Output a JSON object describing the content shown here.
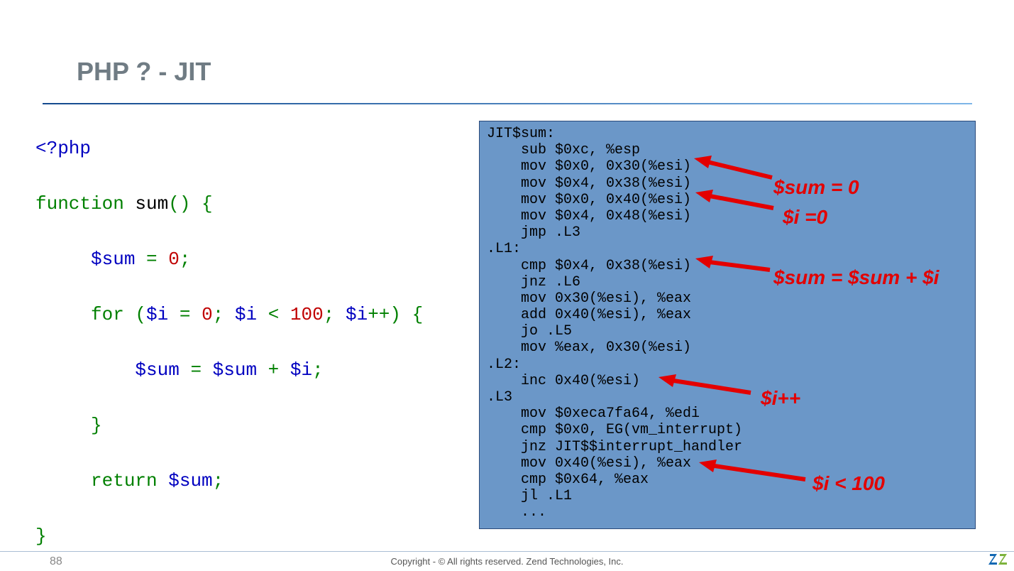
{
  "title": "PHP ? - JIT",
  "php": {
    "open": "<?php",
    "func": "function",
    "name": " sum",
    "paren": "() {",
    "l2a": "     $sum",
    "l2b": " = ",
    "l2c": "0",
    "l2d": ";",
    "l3a": "     for",
    "l3b": " (",
    "l3c": "$i",
    "l3d": " = ",
    "l3e": "0",
    "l3f": "; ",
    "l3g": "$i",
    "l3h": " < ",
    "l3i": "100",
    "l3j": "; ",
    "l3k": "$i",
    "l3l": "++) {",
    "l4a": "         $sum",
    "l4b": " = ",
    "l4c": "$sum",
    "l4d": " + ",
    "l4e": "$i",
    "l4f": ";",
    "l5": "     }",
    "l6a": "     return",
    "l6b": " $sum",
    "l6c": ";",
    "l7": "}"
  },
  "asm": "JIT$sum:\n    sub $0xc, %esp\n    mov $0x0, 0x30(%esi)\n    mov $0x4, 0x38(%esi)\n    mov $0x0, 0x40(%esi)\n    mov $0x4, 0x48(%esi)\n    jmp .L3\n.L1:\n    cmp $0x4, 0x38(%esi)\n    jnz .L6\n    mov 0x30(%esi), %eax\n    add 0x40(%esi), %eax\n    jo .L5\n    mov %eax, 0x30(%esi)\n.L2:\n    inc 0x40(%esi)\n.L3\n    mov $0xeca7fa64, %edi\n    cmp $0x0, EG(vm_interrupt)\n    jnz JIT$$interrupt_handler\n    mov 0x40(%esi), %eax\n    cmp $0x64, %eax\n    jl .L1\n    ...",
  "annotations": {
    "a1": "$sum = 0",
    "a2": "$i =0",
    "a3": "$sum = $sum + $i",
    "a4": "$i++",
    "a5": "$i < 100"
  },
  "footer": {
    "num": "88",
    "copy": "Copyright - © All rights reserved. Zend Technologies, Inc."
  }
}
